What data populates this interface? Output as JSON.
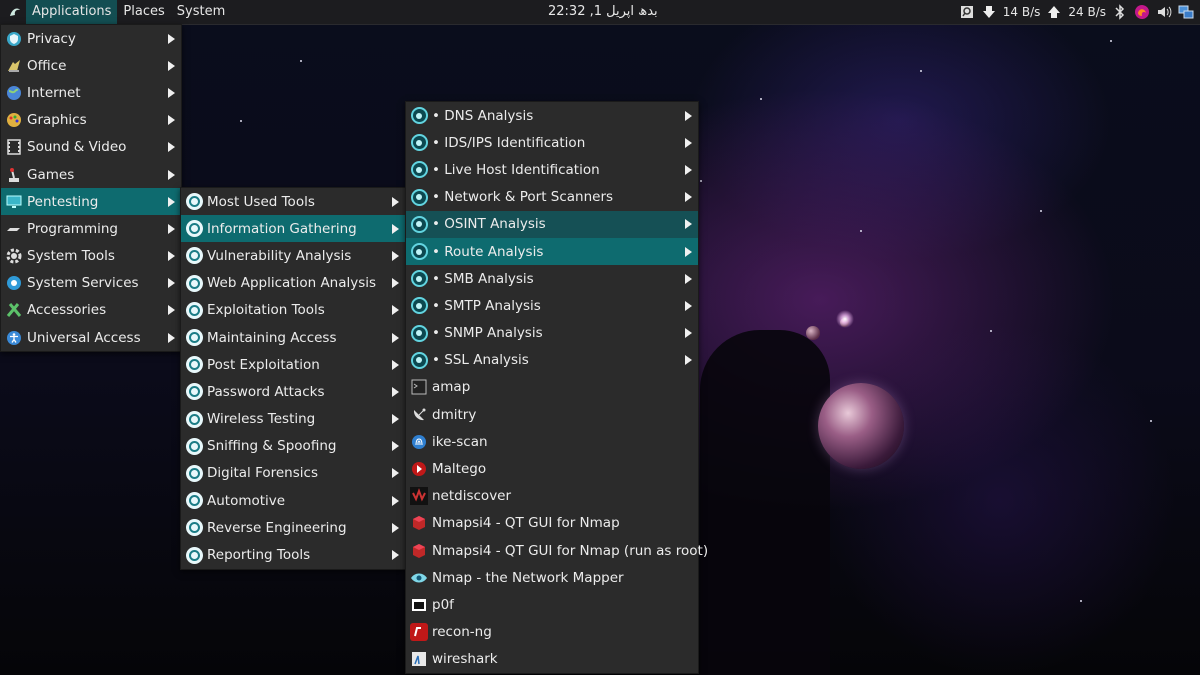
{
  "panel": {
    "menus": [
      "Applications",
      "Places",
      "System"
    ],
    "clock": "بدھ اپریل 1, 22:32",
    "net_down": "14 B/s",
    "net_up": "24 B/s"
  },
  "main_menu": [
    {
      "label": "Privacy",
      "icon": "shield-icon",
      "color": "#3aa7c8"
    },
    {
      "label": "Office",
      "icon": "office-icon",
      "color": "#d8c46a"
    },
    {
      "label": "Internet",
      "icon": "globe-icon",
      "color": "#4a86d8"
    },
    {
      "label": "Graphics",
      "icon": "palette-icon",
      "color": "#e0b040"
    },
    {
      "label": "Sound & Video",
      "icon": "film-icon",
      "color": "#dddddd"
    },
    {
      "label": "Games",
      "icon": "joystick-icon",
      "color": "#dddddd"
    },
    {
      "label": "Pentesting",
      "icon": "monitor-icon",
      "color": "#3ab6c8",
      "selected": true
    },
    {
      "label": "Programming",
      "icon": "code-icon",
      "color": "#dddddd"
    },
    {
      "label": "System Tools",
      "icon": "gear-icon",
      "color": "#dddddd"
    },
    {
      "label": "System Services",
      "icon": "services-icon",
      "color": "#2f9ad8"
    },
    {
      "label": "Accessories",
      "icon": "tools-icon",
      "color": "#5cc26a"
    },
    {
      "label": "Universal Access",
      "icon": "accessibility-icon",
      "color": "#3a8ad8"
    }
  ],
  "pentest_menu": [
    {
      "label": "Most Used Tools"
    },
    {
      "label": "Information Gathering",
      "selected": true
    },
    {
      "label": "Vulnerability Analysis"
    },
    {
      "label": "Web Application Analysis"
    },
    {
      "label": "Exploitation Tools"
    },
    {
      "label": "Maintaining Access"
    },
    {
      "label": "Post Exploitation"
    },
    {
      "label": "Password Attacks"
    },
    {
      "label": "Wireless Testing"
    },
    {
      "label": "Sniffing & Spoofing"
    },
    {
      "label": "Digital Forensics"
    },
    {
      "label": "Automotive"
    },
    {
      "label": "Reverse Engineering"
    },
    {
      "label": "Reporting Tools"
    }
  ],
  "info_menu": [
    {
      "label": "• DNS Analysis",
      "submenu": true
    },
    {
      "label": "• IDS/IPS Identification",
      "submenu": true
    },
    {
      "label": "• Live Host Identification",
      "submenu": true
    },
    {
      "label": "• Network & Port Scanners",
      "submenu": true
    },
    {
      "label": "• OSINT Analysis",
      "submenu": true,
      "hover": true
    },
    {
      "label": "• Route Analysis",
      "submenu": true,
      "selected": true
    },
    {
      "label": "• SMB Analysis",
      "submenu": true
    },
    {
      "label": "• SMTP Analysis",
      "submenu": true
    },
    {
      "label": "• SNMP Analysis",
      "submenu": true
    },
    {
      "label": "• SSL Analysis",
      "submenu": true
    },
    {
      "label": "amap",
      "icon": "terminal-icon"
    },
    {
      "label": "dmitry",
      "icon": "satellite-icon"
    },
    {
      "label": "ike-scan",
      "icon": "fingerprint-icon"
    },
    {
      "label": "Maltego",
      "icon": "maltego-icon"
    },
    {
      "label": "netdiscover",
      "icon": "netdiscover-icon"
    },
    {
      "label": "Nmapsi4 - QT GUI for Nmap",
      "icon": "cube-icon"
    },
    {
      "label": "Nmapsi4 - QT GUI for Nmap (run as root)",
      "icon": "cube-icon"
    },
    {
      "label": "Nmap - the Network Mapper",
      "icon": "eye-icon"
    },
    {
      "label": "p0f",
      "icon": "p0f-icon"
    },
    {
      "label": "recon-ng",
      "icon": "recon-icon"
    },
    {
      "label": "wireshark",
      "icon": "wireshark-icon"
    }
  ]
}
